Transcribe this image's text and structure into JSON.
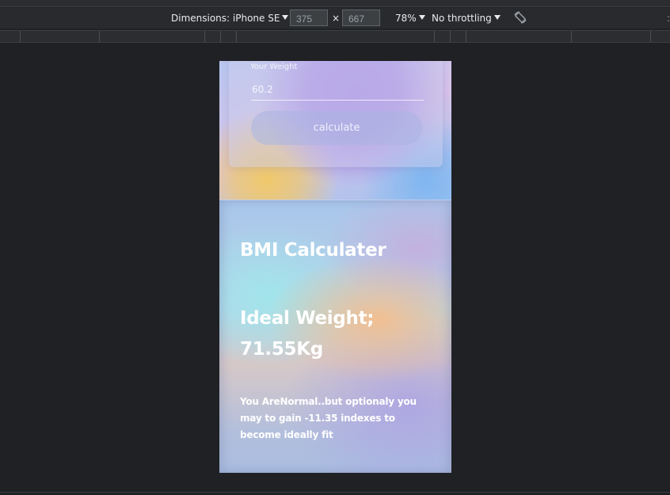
{
  "devtools": {
    "dimensions_label": "Dimensions: iPhone SE",
    "width_value": "375",
    "height_value": "667",
    "times_symbol": "×",
    "zoom_label": "78%",
    "throttle_label": "No throttling",
    "rotate_icon": "rotate-icon"
  },
  "app": {
    "weight_label": "Your Weight",
    "weight_value": "60.2",
    "calculate_label": "calculate",
    "title": "BMI Calculater",
    "ideal_label": "Ideal Weight;",
    "ideal_value": "71.55Kg",
    "message": "You AreNormal..but optionaly you may to gain -11.35 indexes to become ideally fit"
  }
}
